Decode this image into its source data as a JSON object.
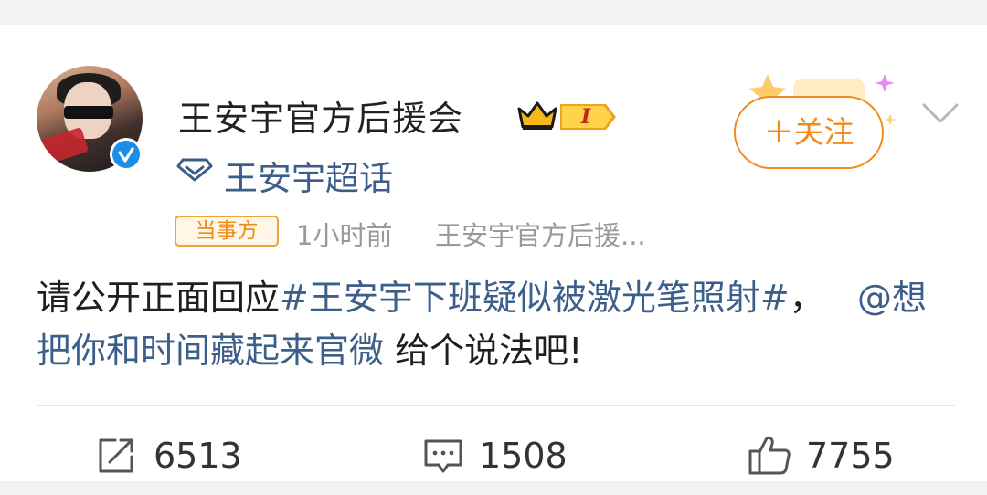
{
  "post": {
    "user_name": "王安宇官方后援会",
    "level_label": "I",
    "topic": "王安宇超话",
    "role_badge": "当事方",
    "timestamp": "1小时前",
    "source": "王安宇官方后援...",
    "follow_label": "＋关注",
    "text": {
      "prefix": "请公开正面回应",
      "hashtag": "#王安宇下班疑似被激光笔照射#",
      "separator": "，",
      "mention": "@想把你和时间藏起来官微",
      "suffix": "给个说法吧!"
    }
  },
  "actions": {
    "repost": {
      "icon": "repost-icon",
      "count": "6513"
    },
    "comment": {
      "icon": "comment-icon",
      "count": "1508"
    },
    "like": {
      "icon": "thumbs-up-icon",
      "count": "7755"
    }
  },
  "colors": {
    "accent_orange": "#f28a1a",
    "link_blue": "#3b5e8a",
    "verified_blue": "#1b8fe8",
    "badge_red": "#c2261a"
  }
}
